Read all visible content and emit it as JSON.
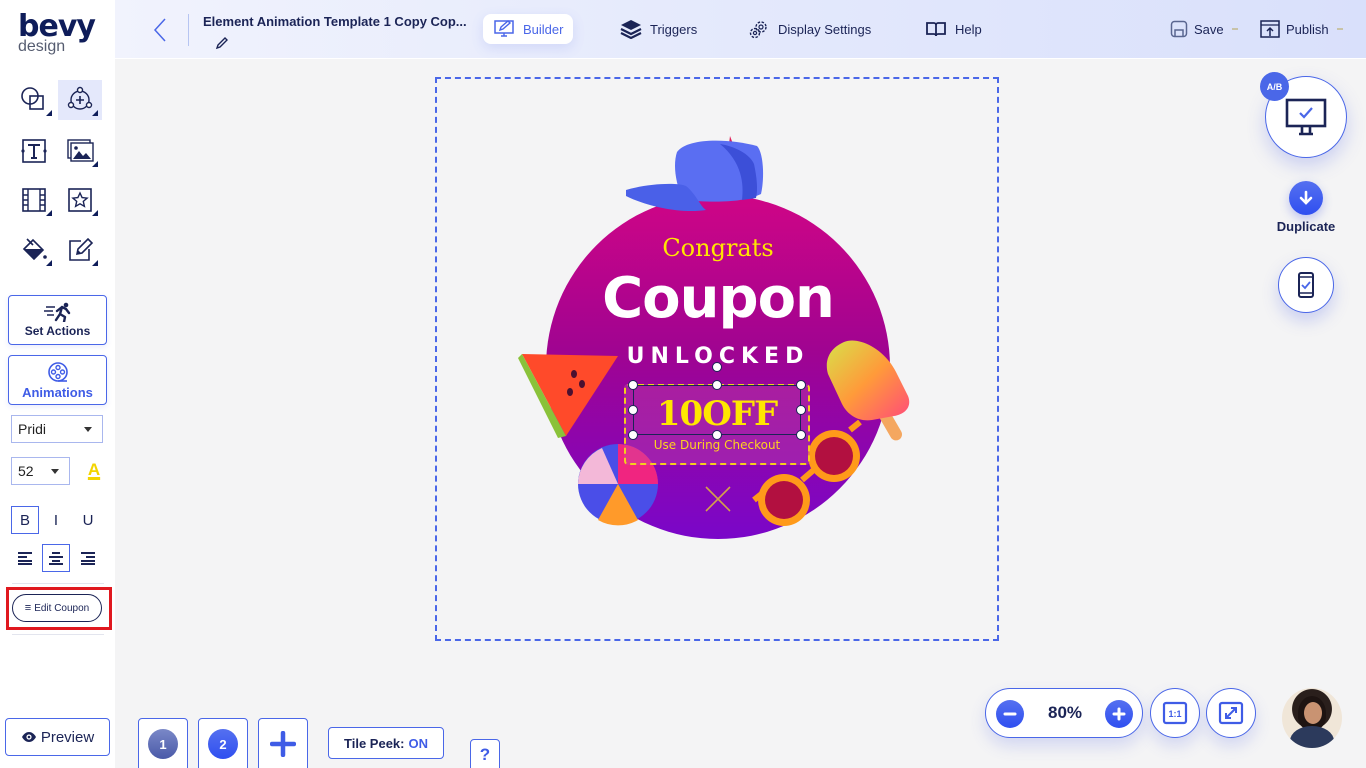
{
  "app": {
    "logo_main": "bevy",
    "logo_sub": "design"
  },
  "header": {
    "title": "Element Animation Template 1 Copy Cop...",
    "nav": [
      {
        "label": "Builder",
        "icon": "builder-icon",
        "active": true
      },
      {
        "label": "Triggers",
        "icon": "layers-icon",
        "active": false
      },
      {
        "label": "Display Settings",
        "icon": "gear-icon",
        "active": false
      },
      {
        "label": "Help",
        "icon": "book-icon",
        "active": false
      }
    ],
    "save_label": "Save",
    "publish_label": "Publish"
  },
  "sidebar": {
    "tools": [
      {
        "name": "shapes",
        "icon": "shapes-icon"
      },
      {
        "name": "elements",
        "icon": "elements-add-icon",
        "active": true
      },
      {
        "name": "text",
        "icon": "text-icon"
      },
      {
        "name": "image",
        "icon": "image-icon"
      },
      {
        "name": "video",
        "icon": "film-icon"
      },
      {
        "name": "icons",
        "icon": "star-icon"
      },
      {
        "name": "fill",
        "icon": "paint-bucket-icon"
      },
      {
        "name": "edit",
        "icon": "edit-pencil-icon"
      }
    ],
    "set_actions_label": "Set Actions",
    "animations_label": "Animations",
    "font_family": "Pridi",
    "font_size": "52",
    "text_color_glyph": "A",
    "text_color": "#f3d400",
    "bold": "B",
    "italic": "I",
    "underline": "U",
    "edit_coupon_label": "Edit Coupon",
    "preview_label": "Preview"
  },
  "canvas": {
    "congrats": "Congrats",
    "coupon": "Coupon",
    "unlocked": "UNLOCKED",
    "code": "10OFF",
    "use_text": "Use During Checkout",
    "gradient_top": "#cf0586",
    "gradient_bottom": "#7a06c9",
    "accent_yellow": "#ffe600"
  },
  "right_panel": {
    "ab_badge": "A/B",
    "duplicate_label": "Duplicate"
  },
  "bottom": {
    "pages": [
      "1",
      "2"
    ],
    "add_page_glyph": "+",
    "tile_peek_label": "Tile Peek:",
    "tile_peek_value": "ON",
    "help_glyph": "?",
    "zoom_value": "80%",
    "one_to_one": "1:1"
  },
  "colors": {
    "accent": "#4a67e8",
    "navy": "#1b2456",
    "highlight": "#e0181f"
  }
}
